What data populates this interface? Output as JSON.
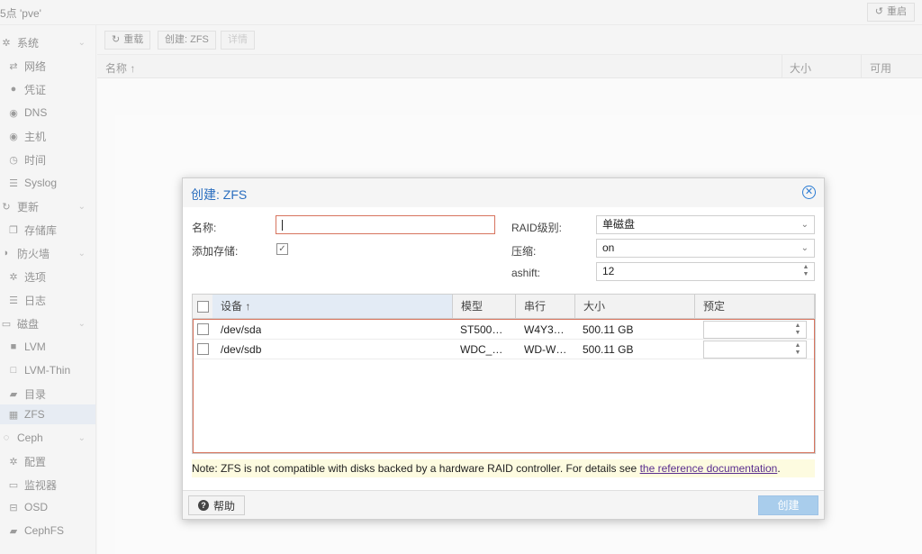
{
  "topbar": {
    "node_title": "5点 'pve'",
    "reboot_label": "重启"
  },
  "sidebar": {
    "items": [
      {
        "label": "系统",
        "icon": "gear-icon"
      },
      {
        "label": "网络",
        "icon": "swap-icon"
      },
      {
        "label": "凭证",
        "icon": "certificate-icon"
      },
      {
        "label": "DNS",
        "icon": "globe-icon"
      },
      {
        "label": "主机",
        "icon": "globe-icon"
      },
      {
        "label": "时间",
        "icon": "clock-icon"
      },
      {
        "label": "Syslog",
        "icon": "list-icon"
      },
      {
        "label": "更新",
        "icon": "refresh-icon"
      },
      {
        "label": "存储库",
        "icon": "files-icon"
      },
      {
        "label": "防火墙",
        "icon": "shield-icon"
      },
      {
        "label": "选项",
        "icon": "gear-icon"
      },
      {
        "label": "日志",
        "icon": "list-icon"
      },
      {
        "label": "磁盘",
        "icon": "disk-icon"
      },
      {
        "label": "LVM",
        "icon": "square-icon"
      },
      {
        "label": "LVM-Thin",
        "icon": "square-outline-icon"
      },
      {
        "label": "目录",
        "icon": "folder-icon"
      },
      {
        "label": "ZFS",
        "icon": "grid-icon"
      },
      {
        "label": "Ceph",
        "icon": "ceph-icon"
      },
      {
        "label": "配置",
        "icon": "gear-icon"
      },
      {
        "label": "监视器",
        "icon": "monitor-icon"
      },
      {
        "label": "OSD",
        "icon": "hdd-icon"
      },
      {
        "label": "CephFS",
        "icon": "folder-icon"
      }
    ]
  },
  "toolbar": {
    "reload_label": "重载",
    "create_zfs_label": "创建: ZFS",
    "detail_label": "详情"
  },
  "grid": {
    "col_name": "名称 ↑",
    "col_size": "大小",
    "col_free": "可用"
  },
  "dialog": {
    "title": "创建: ZFS",
    "name_label": "名称:",
    "name_value": "",
    "add_storage_label": "添加存储:",
    "add_storage_checked": true,
    "raid_label": "RAID级别:",
    "raid_value": "单磁盘",
    "compression_label": "压缩:",
    "compression_value": "on",
    "ashift_label": "ashift:",
    "ashift_value": "12",
    "disk_table": {
      "columns": [
        "设备 ↑",
        "模型",
        "串行",
        "大小",
        "预定"
      ],
      "rows": [
        {
          "device": "/dev/sda",
          "model": "ST500…",
          "serial": "W4Y3…",
          "size": "500.11 GB",
          "order": ""
        },
        {
          "device": "/dev/sdb",
          "model": "WDC_…",
          "serial": "WD-W…",
          "size": "500.11 GB",
          "order": ""
        }
      ]
    },
    "note_text": "Note: ZFS is not compatible with disks backed by a hardware RAID controller. For details see ",
    "note_link": "the reference documentation",
    "note_end": ".",
    "help_label": "帮助",
    "create_label": "创建"
  },
  "colors": {
    "accent": "#2a6ebf",
    "invalid_border": "#d7745e",
    "create_disabled": "#a9cdec",
    "note_bg": "#fdfbe0"
  }
}
